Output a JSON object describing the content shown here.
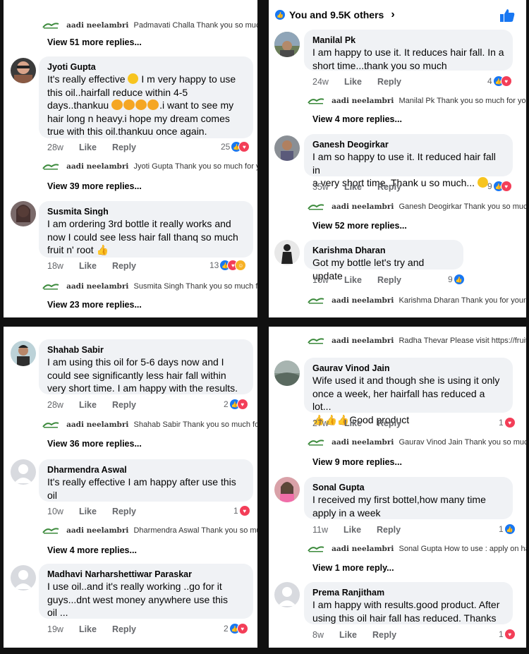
{
  "panel_tl": {
    "top_reply": {
      "name": "aadi neelambri",
      "text": "Padmavati Challa Thank you so much ..."
    },
    "top_more": "View 51 more replies...",
    "comments": [
      {
        "author": "Jyoti Gupta",
        "lines": [
          "It's really effective",
          "I m very happy to use",
          "this oil..hairfall reduce within 4-5",
          "days..thankuu",
          ".i want to see my",
          "hair long n heavy.i hope my dream comes",
          "true with this oil.thankuu once again."
        ],
        "time": "28w",
        "like": "Like",
        "reply": "Reply",
        "count": "25",
        "reply_row": {
          "name": "aadi neelambri",
          "text": "Jyoti Gupta Thank you so much for yo..."
        },
        "more": "View 39 more replies..."
      },
      {
        "author": "Susmita Singh",
        "lines": [
          "I am ordering 3rd bottle it really works and",
          "now I could see less hair fall thanq so much",
          "fruit n' root"
        ],
        "time": "18w",
        "like": "Like",
        "reply": "Reply",
        "count": "13",
        "reply_row": {
          "name": "aadi neelambri",
          "text": "Susmita Singh Thank you so much for..."
        },
        "more": "View 23 more replies..."
      }
    ]
  },
  "panel_tr": {
    "header": "You and 9.5K others",
    "comments": [
      {
        "author": "Manilal Pk",
        "lines": [
          "I am happy to use it. It reduces hair fall. In a",
          "short time...thank you so much"
        ],
        "time": "24w",
        "like": "Like",
        "reply": "Reply",
        "count": "4",
        "reply_row": {
          "name": "aadi neelambri",
          "text": "Manilal Pk Thank you so much for you..."
        },
        "more": "View 4 more replies..."
      },
      {
        "author": "Ganesh Deogirkar",
        "lines": [
          "I am so happy to use it. It reduced hair fall in",
          "a very short time. Thank u so much..."
        ],
        "time": "35w",
        "like": "Like",
        "reply": "Reply",
        "count": "9",
        "reply_row": {
          "name": "aadi neelambri",
          "text": "Ganesh Deogirkar Thank you so much..."
        },
        "more": "View 52 more replies..."
      },
      {
        "author": "Karishma Dharan",
        "lines": [
          "Got my bottle let's try and update"
        ],
        "time": "16w",
        "like": "Like",
        "reply": "Reply",
        "count": "9",
        "reply_row": {
          "name": "aadi neelambri",
          "text": "Karishma Dharan Thank you for your i..."
        },
        "more": ""
      }
    ]
  },
  "panel_bl": {
    "comments": [
      {
        "author": "Shahab Sabir",
        "lines": [
          "I am using this oil for 5-6 days now and I",
          "could see significantly less hair fall within",
          "very short time. I am happy with the results."
        ],
        "time": "28w",
        "like": "Like",
        "reply": "Reply",
        "count": "2",
        "reply_row": {
          "name": "aadi neelambri",
          "text": "Shahab Sabir Thank you so much for ..."
        },
        "more": "View 36 more replies..."
      },
      {
        "author": "Dharmendra Aswal",
        "lines": [
          "It's really effective I am happy after use this",
          "oil"
        ],
        "time": "10w",
        "like": "Like",
        "reply": "Reply",
        "count": "1",
        "reply_row": {
          "name": "aadi neelambri",
          "text": "Dharmendra Aswal Thank you so muc..."
        },
        "more": "View 4 more replies..."
      },
      {
        "author": "Madhavi Narharshettiwar Paraskar",
        "lines": [
          "I use oil..and it's  really working ..go for it",
          "guys...dnt west money anywhere use this",
          "oil ..."
        ],
        "time": "19w",
        "like": "Like",
        "reply": "Reply",
        "count": "2",
        "reply_row": null,
        "more": ""
      }
    ]
  },
  "panel_br": {
    "top_reply": {
      "name": "aadi neelambri",
      "text": "Radha Thevar Please visit https://fruit..."
    },
    "comments": [
      {
        "author": "Gaurav Vinod Jain",
        "lines": [
          "Wife used it and though she is using it only",
          "once a week, her hairfall has reduced a lot...",
          "Good product"
        ],
        "time": "27w",
        "like": "Like",
        "reply": "Reply",
        "count": "1",
        "reply_row": {
          "name": "aadi neelambri",
          "text": "Gaurav Vinod Jain Thank you so much..."
        },
        "more": "View 9 more replies..."
      },
      {
        "author": "Sonal Gupta",
        "lines": [
          "I received my first bottel,how many time",
          "apply in a week"
        ],
        "time": "11w",
        "like": "Like",
        "reply": "Reply",
        "count": "1",
        "reply_row": {
          "name": "aadi neelambri",
          "text": "Sonal Gupta How to use : apply on hai..."
        },
        "more": "View 1 more reply..."
      },
      {
        "author": "Prema Ranjitham",
        "lines": [
          "I am happy with results.good product. After",
          "using this oil hair fall has reduced. Thanks"
        ],
        "time": "8w",
        "like": "Like",
        "reply": "Reply",
        "count": "1",
        "reply_row": null,
        "more": ""
      }
    ]
  },
  "colors": {
    "like": "#1877f2",
    "love": "#f33e58",
    "haha": "#f7b125",
    "bubble": "#f0f2f5"
  }
}
